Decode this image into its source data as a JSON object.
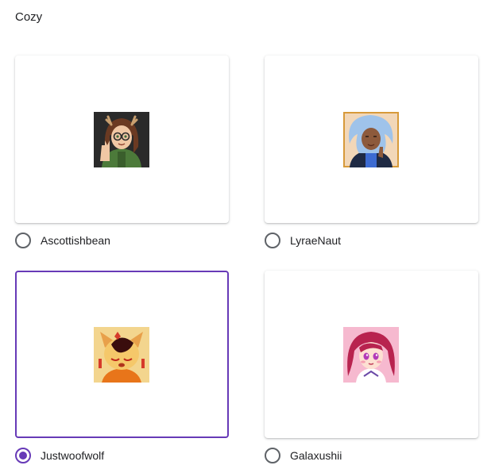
{
  "section": {
    "title": "Cozy"
  },
  "options": [
    {
      "label": "Ascottishbean",
      "selected": false,
      "avatar": "brunette-girl-with-antlers-avatar"
    },
    {
      "label": "LyraeNaut",
      "selected": false,
      "avatar": "blue-haired-person-avatar"
    },
    {
      "label": "Justwoofwolf",
      "selected": true,
      "avatar": "orange-wolf-avatar"
    },
    {
      "label": "Galaxushii",
      "selected": false,
      "avatar": "pink-haired-anime-girl-avatar"
    }
  ],
  "colors": {
    "accent": "#673ab7",
    "radio_unchecked": "#5f6368",
    "text": "#202124"
  }
}
